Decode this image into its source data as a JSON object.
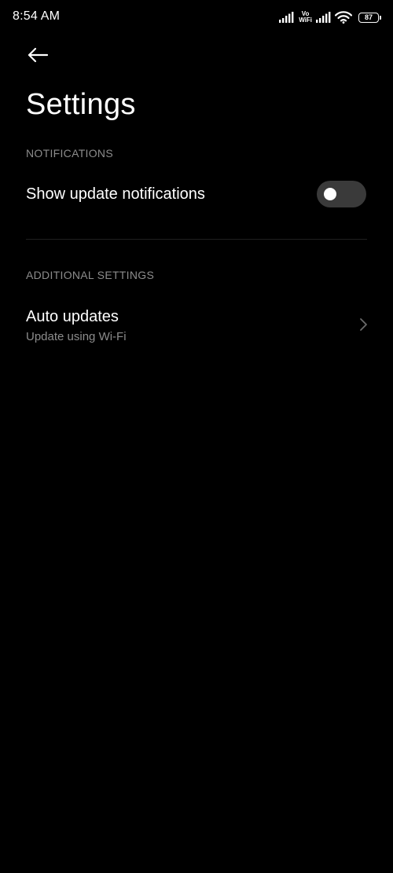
{
  "status_bar": {
    "time": "8:54 AM",
    "vowifi_top": "Vo",
    "vowifi_bottom": "WiFi",
    "battery_level": "87"
  },
  "header": {
    "back_icon": "arrow-left-icon",
    "title": "Settings"
  },
  "sections": {
    "notifications": {
      "header": "NOTIFICATIONS",
      "show_update_notifications": {
        "label": "Show update notifications",
        "enabled": false
      }
    },
    "additional": {
      "header": "ADDITIONAL SETTINGS",
      "auto_updates": {
        "label": "Auto updates",
        "subtitle": "Update using Wi-Fi",
        "icon": "chevron-right-icon"
      }
    }
  },
  "colors": {
    "background": "#000000",
    "text_primary": "#ffffff",
    "text_secondary": "#8c8c8c",
    "toggle_track_off": "#3a3a3a",
    "divider": "#1f1f1f"
  }
}
